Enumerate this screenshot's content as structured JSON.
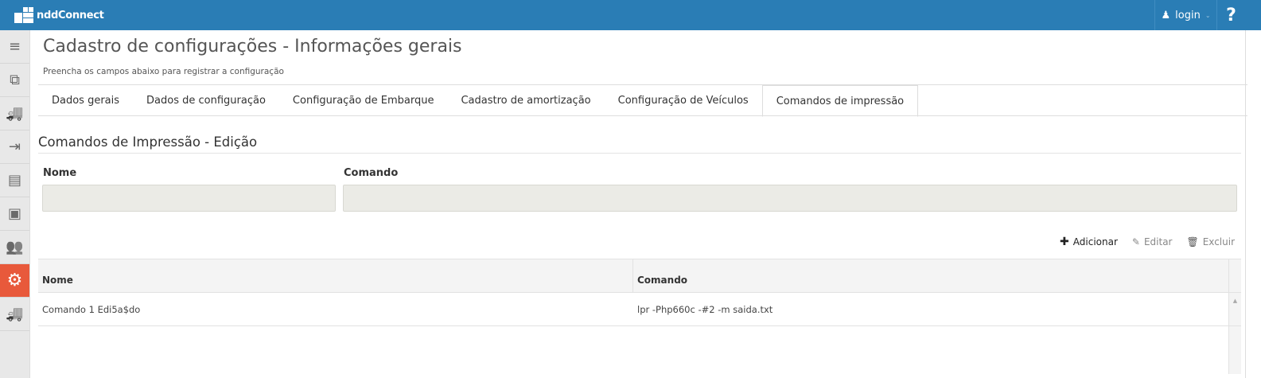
{
  "header": {
    "brand": "nddConnect",
    "login_label": "login",
    "help_label": "?"
  },
  "sidebar": {
    "items": [
      {
        "icon": "menu-icon",
        "glyph": "≡"
      },
      {
        "icon": "copy-icon",
        "glyph": "⧉"
      },
      {
        "icon": "truck-icon",
        "glyph": "🚚"
      },
      {
        "icon": "export-icon",
        "glyph": "⇥"
      },
      {
        "icon": "document-icon",
        "glyph": "▤"
      },
      {
        "icon": "money-icon",
        "glyph": "▣"
      },
      {
        "icon": "users-icon",
        "glyph": "👥"
      },
      {
        "icon": "gears-icon",
        "glyph": "⚙"
      },
      {
        "icon": "truck-icon",
        "glyph": "🚚"
      }
    ]
  },
  "page": {
    "title": "Cadastro de configurações - Informações gerais",
    "subtitle": "Preencha os campos abaixo para registrar a configuração"
  },
  "tabs": [
    "Dados gerais",
    "Dados de configuração",
    "Configuração de Embarque",
    "Cadastro de amortização",
    "Configuração de Veículos",
    "Comandos de impressão"
  ],
  "section": {
    "title": "Comandos de Impressão - Edição"
  },
  "form": {
    "nome_label": "Nome",
    "nome_value": "",
    "comando_label": "Comando",
    "comando_value": ""
  },
  "actions": {
    "add": "Adicionar",
    "edit": "Editar",
    "delete": "Excluir"
  },
  "table": {
    "columns": [
      "Nome",
      "Comando"
    ],
    "rows": [
      [
        "Comando 1 Edi5a$do",
        "lpr -Php660c -#2 -m saida.txt"
      ]
    ]
  }
}
